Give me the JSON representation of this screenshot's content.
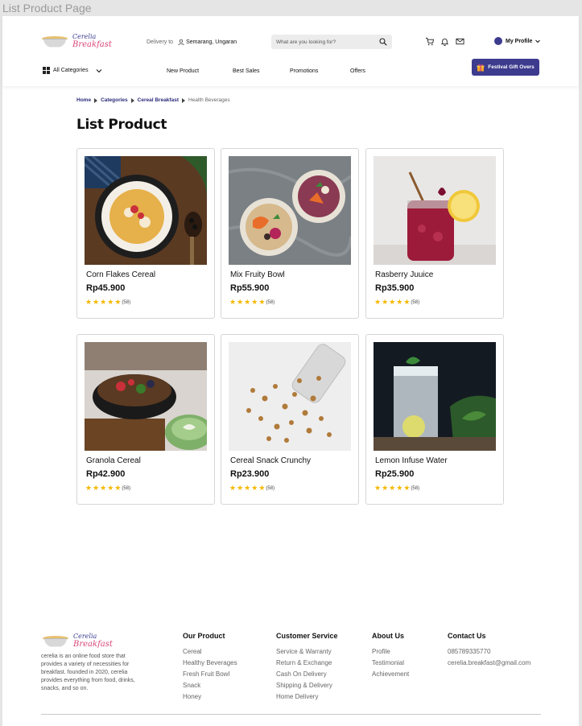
{
  "frame_title": "List Product Page",
  "brand": {
    "line1": "Cerelia",
    "line2": "Breakfast"
  },
  "header": {
    "delivery_label": "Delivery to",
    "delivery_location": "Semarang, Ungaran",
    "search_placeholder": "What are you looking for?",
    "profile_label": "My Profile",
    "all_categories": "All Categories",
    "nav": [
      "New Product",
      "Best Sales",
      "Promotions",
      "Offers"
    ],
    "gift_button": "Festival Gift Overs"
  },
  "breadcrumb": [
    "Home",
    "Categories",
    "Cereal Breakfast",
    "Health Beverages"
  ],
  "page_title": "List Product",
  "products": [
    {
      "name": "Corn Flakes Cereal",
      "price": "Rp45.900",
      "rating": 5,
      "reviews": "(58)"
    },
    {
      "name": "Mix Fruity Bowl",
      "price": "Rp55.900",
      "rating": 5,
      "reviews": "(58)"
    },
    {
      "name": "Rasberry Juuice",
      "price": "Rp35.900",
      "rating": 5,
      "reviews": "(58)"
    },
    {
      "name": "Granola Cereal",
      "price": "Rp42.900",
      "rating": 5,
      "reviews": "(58)"
    },
    {
      "name": "Cereal Snack Crunchy",
      "price": "Rp23.900",
      "rating": 5,
      "reviews": "(58)"
    },
    {
      "name": "Lemon Infuse Water",
      "price": "Rp25.900",
      "rating": 5,
      "reviews": "(58)"
    }
  ],
  "footer": {
    "description": "cerelia is an online food store that provides a variety of necessities for breakfast. founded in 2020, cerelia provides everything from food, drinks, snacks, and so on.",
    "our_product": {
      "title": "Our Product",
      "items": [
        "Cereal",
        "Healthy Beverages",
        "Fresh Fruit Bowl",
        "Snack",
        "Honey"
      ]
    },
    "customer_service": {
      "title": "Customer Service",
      "items": [
        "Service & Warranty",
        "Return & Exchange",
        "Cash On Delivery",
        "Shipping & Delivery",
        "Home Delivery"
      ]
    },
    "about_us": {
      "title": "About Us",
      "items": [
        "Profile",
        "Testimonial",
        "Achievement"
      ]
    },
    "contact_us": {
      "title": "Contact Us",
      "items": [
        "085789335770",
        "cerelia.breakfast@gmail.com"
      ]
    }
  },
  "colors": {
    "primary": "#3d3b8e",
    "accent": "#d9467a",
    "star": "#f5b800"
  },
  "icons": [
    "search-icon",
    "cart-icon",
    "bell-icon",
    "mail-icon",
    "user-icon",
    "grid-icon",
    "chevron-down-icon",
    "gift-icon",
    "pin-icon",
    "star-icon"
  ]
}
